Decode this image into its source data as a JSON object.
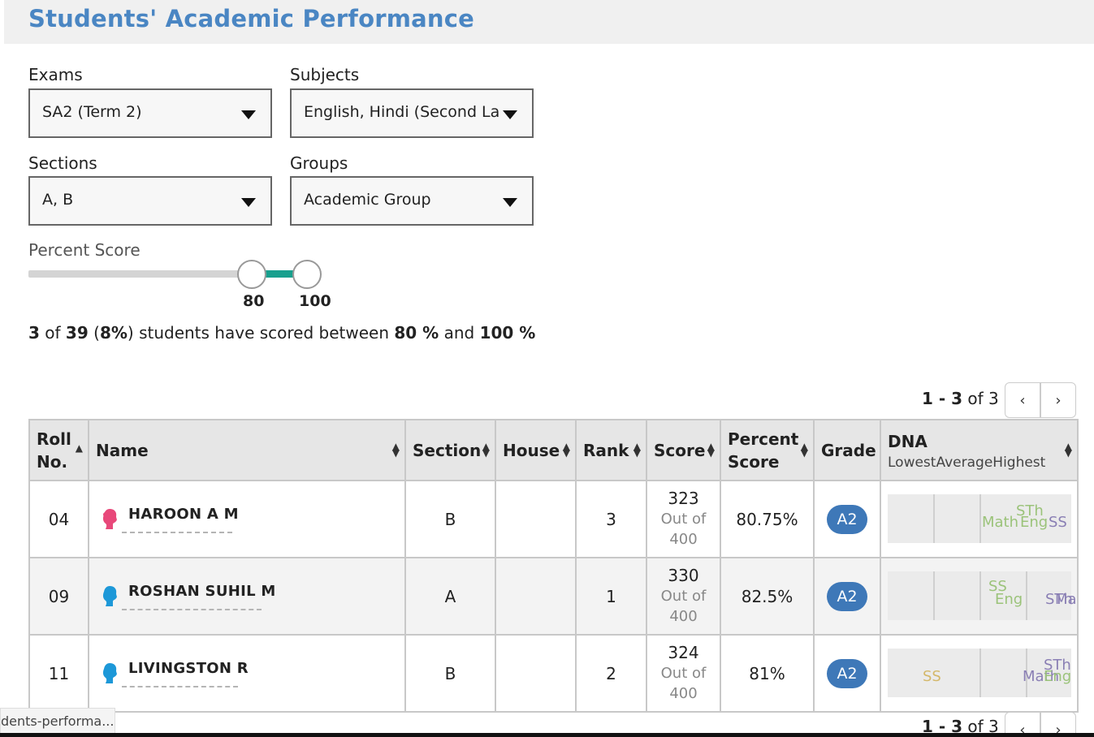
{
  "page": {
    "title": "Students' Academic Performance"
  },
  "filters": {
    "exams": {
      "label": "Exams",
      "value": "SA2 (Term 2)"
    },
    "subjects": {
      "label": "Subjects",
      "value": "English, Hindi (Second La..."
    },
    "sections": {
      "label": "Sections",
      "value": "A, B"
    },
    "groups": {
      "label": "Groups",
      "value": "Academic Group"
    }
  },
  "percent_score": {
    "label": "Percent Score",
    "min": "80",
    "max": "100"
  },
  "summary": {
    "count": "3",
    "of_word": " of ",
    "total": "39",
    "percent_open": " (",
    "percent": "8%",
    "text": ") students have scored between ",
    "low": "80 %",
    "and_word": " and ",
    "high": "100 %"
  },
  "pager": {
    "range": "1 - 3",
    "of_text": " of 3",
    "prev": "‹",
    "next": "›"
  },
  "table": {
    "headers": {
      "roll": "Roll No.",
      "name": "Name",
      "section": "Section",
      "house": "House",
      "rank": "Rank",
      "score": "Score",
      "percent": "Percent Score",
      "grade": "Grade",
      "dna": "DNA",
      "dna_lowest": "Lowest",
      "dna_average": "Average",
      "dna_highest": "Highest"
    },
    "rows": [
      {
        "roll": "04",
        "name": "HAROON A M",
        "gender": "female",
        "section": "B",
        "house": "",
        "rank": "3",
        "score": "323",
        "out_of": "Out of",
        "max": "400",
        "percent": "80.75%",
        "grade": "A2",
        "dna": [
          "STh",
          "Math",
          "Eng",
          "SS"
        ]
      },
      {
        "roll": "09",
        "name": "ROSHAN SUHIL M",
        "gender": "male",
        "section": "A",
        "house": "",
        "rank": "1",
        "score": "330",
        "out_of": "Out of",
        "max": "400",
        "percent": "82.5%",
        "grade": "A2",
        "dna": [
          "SS",
          "Eng",
          "STh",
          "Ma"
        ]
      },
      {
        "roll": "11",
        "name": "LIVINGSTON R",
        "gender": "male",
        "section": "B",
        "house": "",
        "rank": "2",
        "score": "324",
        "out_of": "Out of",
        "max": "400",
        "percent": "81%",
        "grade": "A2",
        "dna": [
          "SS",
          "STh",
          "Math",
          "Eng"
        ]
      }
    ]
  },
  "status": {
    "url": "dents-performa..."
  },
  "colors": {
    "accent": "#4a86c3",
    "slider": "#18a08e",
    "grade": "#3e78b8",
    "female": "#e8487a",
    "male": "#1d98d8"
  }
}
